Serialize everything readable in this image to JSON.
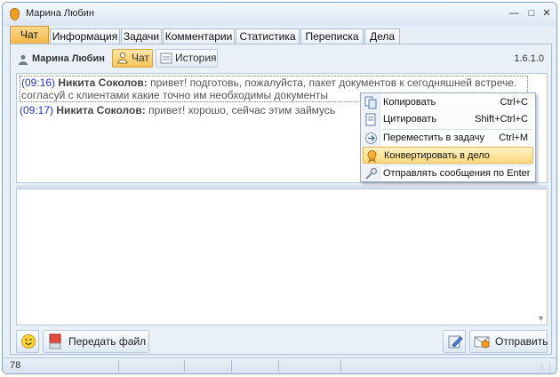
{
  "window": {
    "title": "Марина Любин"
  },
  "tabs": [
    {
      "label": "Чат",
      "active": true
    },
    {
      "label": "Информация"
    },
    {
      "label": "Задачи"
    },
    {
      "label": "Комментарии"
    },
    {
      "label": "Статистика"
    },
    {
      "label": "Переписка"
    },
    {
      "label": "Дела"
    }
  ],
  "userbar": {
    "user_name": "Марина Любин",
    "chat_label": "Чат",
    "history_label": "История",
    "version": "1.6.1.0"
  },
  "messages": [
    {
      "time": "(09:16)",
      "author": "Никита Соколов:",
      "text": "привет! подготовь, пожалуйста, пакет документов к сегодняшней встрече. согласуй с клиентами какие точно им необходимы документы"
    },
    {
      "time": "(09:17)",
      "author": "Никита Соколов:",
      "text": "привет! хорошо, сейчас этим займусь"
    }
  ],
  "context_menu": [
    {
      "label": "Копировать",
      "shortcut": "Ctrl+C",
      "icon": "copy-icon"
    },
    {
      "label": "Цитировать",
      "shortcut": "Shift+Ctrl+C",
      "icon": "quote-icon"
    },
    {
      "label": "Переместить в задачу",
      "shortcut": "Ctrl+M",
      "icon": "move-to-task-icon"
    },
    {
      "label": "Конвертировать в дело",
      "shortcut": "",
      "icon": "convert-icon",
      "highlighted": true
    },
    {
      "label": "Отправлять сообщения по Enter",
      "shortcut": "",
      "icon": "send-settings-icon"
    }
  ],
  "toolbar": {
    "send_file_label": "Передать файл",
    "send_label": "Отправить"
  },
  "status": {
    "count": "78"
  },
  "colors": {
    "accent": "#f5b546",
    "time": "#2233cc",
    "border": "#a9bdd6"
  }
}
